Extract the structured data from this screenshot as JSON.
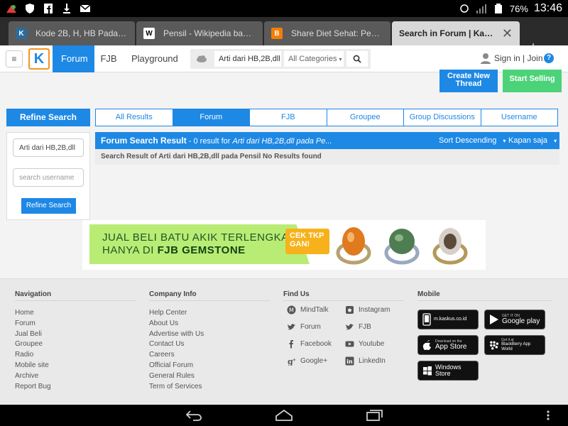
{
  "status_bar": {
    "battery": "76%",
    "time": "13:46"
  },
  "tabs": [
    {
      "title": "Kode 2B, H, HB Pada Pen...",
      "favicon": "kaskus-icon"
    },
    {
      "title": "Pensil - Wikipedia bahas...",
      "favicon": "wikipedia-icon"
    },
    {
      "title": "Share Diet Sehat: Penger...",
      "favicon": "blogger-icon"
    },
    {
      "title": "Search in Forum | Kasku...",
      "favicon": "none",
      "active": true
    }
  ],
  "header": {
    "nav": [
      "Forum",
      "FJB",
      "Playground"
    ],
    "search_value": "Arti dari HB,2B,dll pa",
    "category": "All Categories",
    "signin": "Sign in | Join",
    "help": "?"
  },
  "actions": {
    "create_thread": "Create New Thread",
    "start_selling": "Start Selling"
  },
  "refine": {
    "title": "Refine Search",
    "query_value": "Arti dari HB,2B,dll",
    "username_placeholder": "search username",
    "button": "Refine Search"
  },
  "filter_tabs": [
    "All Results",
    "Forum",
    "FJB",
    "Groupee",
    "Group Discussions",
    "Username"
  ],
  "result": {
    "title": "Forum Search Result",
    "count_text": " - 0 result for ",
    "query": "Arti dari HB,2B,dll pada Pe...",
    "sort": "Sort Descending",
    "time": "Kapan saja",
    "message": "Search Result of Arti dari HB,2B,dll pada Pensil No Results found"
  },
  "banner": {
    "line1": "JUAL BELI BATU AKIK TERLENGKAP",
    "line2_prefix": "HANYA DI ",
    "line2_bold": "FJB GEMSTONE",
    "cta": "CEK TKP GAN!"
  },
  "footer": {
    "navigation": {
      "title": "Navigation",
      "links": [
        "Home",
        "Forum",
        "Jual Beli",
        "Groupee",
        "Radio",
        "Mobile site",
        "Archive",
        "Report Bug"
      ]
    },
    "company": {
      "title": "Company Info",
      "links": [
        "Help Center",
        "About Us",
        "Advertise with Us",
        "Contact Us",
        "Careers",
        "Official Forum",
        "General Rules",
        "Term of Services"
      ]
    },
    "findus": {
      "title": "Find Us",
      "left": [
        "MindTalk",
        "Forum",
        "Facebook",
        "Google+"
      ],
      "right": [
        "Instagram",
        "FJB",
        "Youtube",
        "LinkedIn"
      ]
    },
    "mobile": {
      "title": "Mobile",
      "badges": [
        {
          "small": "",
          "big": "m.kaskus.co.id"
        },
        {
          "small": "GET IT ON",
          "big": "Google play"
        },
        {
          "small": "Download on the",
          "big": "App Store"
        },
        {
          "small": "Get it at",
          "big": "BlackBerry App World"
        },
        {
          "small": "",
          "big": "Windows Store"
        }
      ]
    }
  }
}
